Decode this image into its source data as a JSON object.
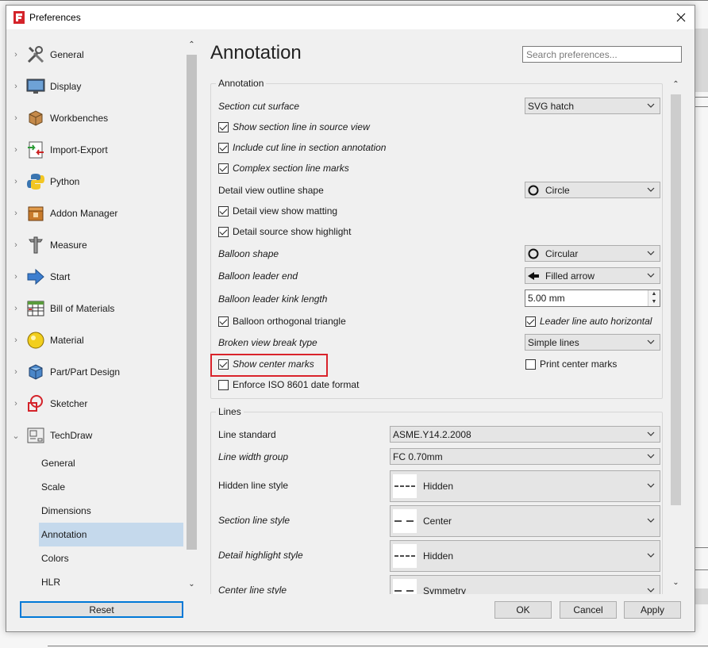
{
  "window": {
    "title": "Preferences",
    "close_icon": "close-icon",
    "app_icon": "freecad-icon"
  },
  "nav": {
    "items": [
      {
        "label": "General",
        "icon": "tools-icon",
        "expanded": false
      },
      {
        "label": "Display",
        "icon": "monitor-icon",
        "expanded": false
      },
      {
        "label": "Workbenches",
        "icon": "box-icon",
        "expanded": false
      },
      {
        "label": "Import-Export",
        "icon": "import-export-icon",
        "expanded": false
      },
      {
        "label": "Python",
        "icon": "python-icon",
        "expanded": false
      },
      {
        "label": "Addon Manager",
        "icon": "addon-icon",
        "expanded": false
      },
      {
        "label": "Measure",
        "icon": "caliper-icon",
        "expanded": false
      },
      {
        "label": "Start",
        "icon": "arrow-right-icon",
        "expanded": false
      },
      {
        "label": "Bill of Materials",
        "icon": "spreadsheet-icon",
        "expanded": false
      },
      {
        "label": "Material",
        "icon": "sphere-icon",
        "expanded": false
      },
      {
        "label": "Part/Part Design",
        "icon": "cube-icon",
        "expanded": false
      },
      {
        "label": "Sketcher",
        "icon": "sketcher-icon",
        "expanded": false
      },
      {
        "label": "TechDraw",
        "icon": "techdraw-icon",
        "expanded": true
      }
    ],
    "techdraw_children": [
      "General",
      "Scale",
      "Dimensions",
      "Annotation",
      "Colors",
      "HLR"
    ],
    "selected_child": "Annotation",
    "reset_label": "Reset"
  },
  "page": {
    "title": "Annotation",
    "search_placeholder": "Search preferences..."
  },
  "annotation_group": {
    "title": "Annotation",
    "section_cut_surface": {
      "label": "Section cut surface",
      "value": "SVG hatch"
    },
    "show_section_line": {
      "label": "Show section line in source view",
      "checked": true
    },
    "include_cut_line": {
      "label": "Include cut line in section annotation",
      "checked": true
    },
    "complex_section_line": {
      "label": "Complex section line marks",
      "checked": true
    },
    "detail_view_outline": {
      "label": "Detail view outline shape",
      "value": "Circle"
    },
    "detail_view_matting": {
      "label": "Detail view show matting",
      "checked": true
    },
    "detail_source_highlight": {
      "label": "Detail source show highlight",
      "checked": true
    },
    "balloon_shape": {
      "label": "Balloon shape",
      "value": "Circular"
    },
    "balloon_leader_end": {
      "label": "Balloon leader end",
      "value": "Filled arrow"
    },
    "balloon_kink_length": {
      "label": "Balloon leader kink length",
      "value": "5.00 mm"
    },
    "balloon_orthogonal": {
      "label": "Balloon orthogonal triangle",
      "checked": true
    },
    "leader_auto_horizontal": {
      "label": "Leader line auto horizontal",
      "checked": true
    },
    "broken_view_break": {
      "label": "Broken view break type",
      "value": "Simple lines"
    },
    "show_center_marks": {
      "label": "Show center marks",
      "checked": true
    },
    "print_center_marks": {
      "label": "Print center marks",
      "checked": false
    },
    "enforce_iso": {
      "label": "Enforce ISO 8601 date format",
      "checked": false
    }
  },
  "lines_group": {
    "title": "Lines",
    "line_standard": {
      "label": "Line standard",
      "value": "ASME.Y14.2.2008"
    },
    "line_width_group": {
      "label": "Line width group",
      "value": "FC 0.70mm"
    },
    "hidden_line_style": {
      "label": "Hidden line style",
      "value": "Hidden"
    },
    "section_line_style": {
      "label": "Section line style",
      "value": "Center"
    },
    "detail_highlight_style": {
      "label": "Detail highlight style",
      "value": "Hidden"
    },
    "center_line_style": {
      "label": "Center line style",
      "value": "Symmetry"
    }
  },
  "buttons": {
    "ok": "OK",
    "cancel": "Cancel",
    "apply": "Apply"
  },
  "colors": {
    "selection": "#c5d9ec",
    "focus": "#0078d7",
    "highlight_box": "#d9232b"
  }
}
